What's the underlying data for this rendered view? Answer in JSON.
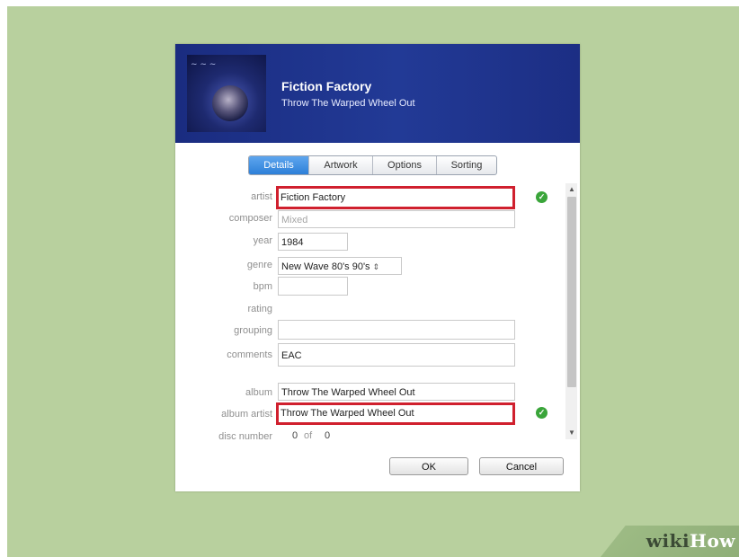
{
  "header": {
    "artist_title": "Fiction Factory",
    "album_subtitle": "Throw The Warped Wheel Out"
  },
  "tabs": [
    {
      "label": "Details",
      "active": true
    },
    {
      "label": "Artwork",
      "active": false
    },
    {
      "label": "Options",
      "active": false
    },
    {
      "label": "Sorting",
      "active": false
    }
  ],
  "fields": {
    "artist": {
      "label": "artist",
      "value": "Fiction Factory"
    },
    "composer": {
      "label": "composer",
      "value": "Mixed"
    },
    "year": {
      "label": "year",
      "value": "1984"
    },
    "genre": {
      "label": "genre",
      "value": "New Wave 80's 90's"
    },
    "bpm": {
      "label": "bpm",
      "value": ""
    },
    "rating": {
      "label": "rating"
    },
    "grouping": {
      "label": "grouping",
      "value": ""
    },
    "comments": {
      "label": "comments",
      "value": "EAC"
    },
    "album": {
      "label": "album",
      "value": "Throw The Warped Wheel Out"
    },
    "album_artist": {
      "label": "album artist",
      "value": "Throw The Warped Wheel Out"
    },
    "disc_number": {
      "label": "disc number",
      "value": "0",
      "of_label": "of",
      "total": "0"
    }
  },
  "buttons": {
    "ok": "OK",
    "cancel": "Cancel"
  },
  "icons": {
    "check": "check-circle-icon",
    "genre_select": "up-down-arrows-icon",
    "scroll_up": "chevron-up-icon",
    "scroll_down": "chevron-down-icon"
  },
  "colors": {
    "header_bg": "#223a96",
    "active_tab": "#2d7fd8",
    "highlight_box": "#d0202e",
    "check": "#3aa53a",
    "page_bg": "#b8d09e"
  },
  "watermark": {
    "wiki": "wiki",
    "how": "How"
  }
}
